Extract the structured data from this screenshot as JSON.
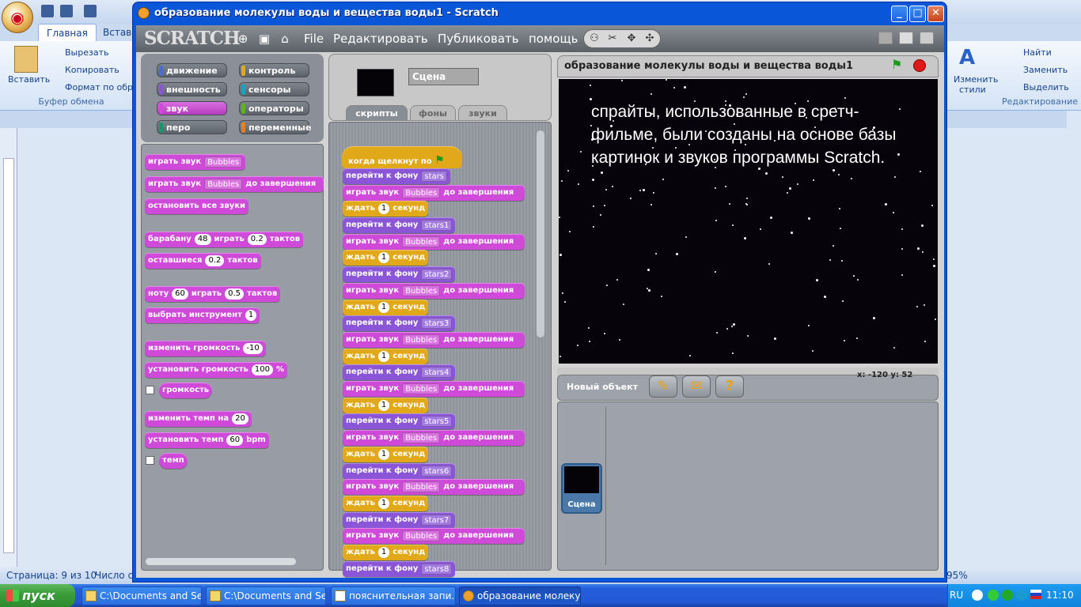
{
  "word": {
    "tabs": [
      "Главная",
      "Вставка"
    ],
    "clipboard": {
      "paste": "Вставить",
      "cut": "Вырезать",
      "copy": "Копировать",
      "format": "Формат по обра",
      "group": "Буфер обмена"
    },
    "styles": {
      "change": "Изменить",
      "change2": "стили"
    },
    "editing": {
      "find": "Найти",
      "replace": "Заменить",
      "select": "Выделить",
      "group": "Редактирование"
    },
    "status": {
      "page": "Страница: 9 из 10",
      "words": "Число сл",
      "zoom": "95%"
    }
  },
  "taskbar": {
    "start": "пуск",
    "tasks": [
      "C:\\Documents and Se...",
      "C:\\Documents and Se...",
      "пояснительная запи...",
      "образование молеку..."
    ],
    "lang": "RU",
    "clock": "11:10"
  },
  "window": {
    "title": "образование молекулы воды и вещества воды1 - Scratch",
    "minimize": "_",
    "maximize": "□",
    "close": "✕"
  },
  "scratch": {
    "logo": "SCRATCH",
    "menu": [
      "File",
      "Редактировать",
      "Публиковать",
      "помощь"
    ],
    "categories": [
      {
        "label": "движение",
        "color": "#4a6cd4"
      },
      {
        "label": "контроль",
        "color": "#e1a91a"
      },
      {
        "label": "внешность",
        "color": "#8a55d7"
      },
      {
        "label": "сенсоры",
        "color": "#0fa5c5"
      },
      {
        "label": "звук",
        "color": "#cf4ad9"
      },
      {
        "label": "операторы",
        "color": "#5cb712"
      },
      {
        "label": "перо",
        "color": "#0e9a6c"
      },
      {
        "label": "переменные",
        "color": "#ee7d16"
      }
    ],
    "palette": {
      "play_sound": "играть звук",
      "bubbles": "Bubbles",
      "until_done": "до завершения",
      "stop_all": "остановить все звуки",
      "drum": "барабану",
      "drum_val": "48",
      "play": "играть",
      "beats_val": "0.2",
      "beats": "тактов",
      "rest": "оставшиеся",
      "rest_val": "0.2",
      "note": "ноту",
      "note_val": "60",
      "note_beats": "0.5",
      "instrument": "выбрать инструмент",
      "instrument_val": "1",
      "change_vol": "изменить громкость",
      "change_vol_val": "-10",
      "set_vol": "установить громкость",
      "set_vol_val": "100",
      "percent": "%",
      "volume": "громкость",
      "change_tempo": "изменить темп на",
      "change_tempo_val": "20",
      "set_tempo": "установить темп",
      "set_tempo_val": "60",
      "bpm": "bpm",
      "tempo": "темп"
    },
    "scene_name": "Сцена",
    "tabs": [
      "скрипты",
      "фоны",
      "звуки"
    ],
    "script": {
      "hat": "когда щелкнут по",
      "switch_bg": "перейти к фону",
      "play_sound": "играть звук",
      "sound": "Bubbles",
      "until_done": "до завершения",
      "wait": "ждать",
      "wait_val": "1",
      "seconds": "секунд",
      "backgrounds": [
        "stars",
        "stars1",
        "stars2",
        "stars3",
        "stars4",
        "stars5",
        "stars6",
        "stars7",
        "stars8"
      ]
    },
    "stage": {
      "title": "образование молекулы воды и вещества воды1",
      "text": "спрайты, использованные в сретч-фильме, были созданы на основе базы картинок и звуков программы Scratch.",
      "coords": "x: -120   y: 52"
    },
    "new_sprite": "Новый объект",
    "scene_tile": "Сцена"
  }
}
